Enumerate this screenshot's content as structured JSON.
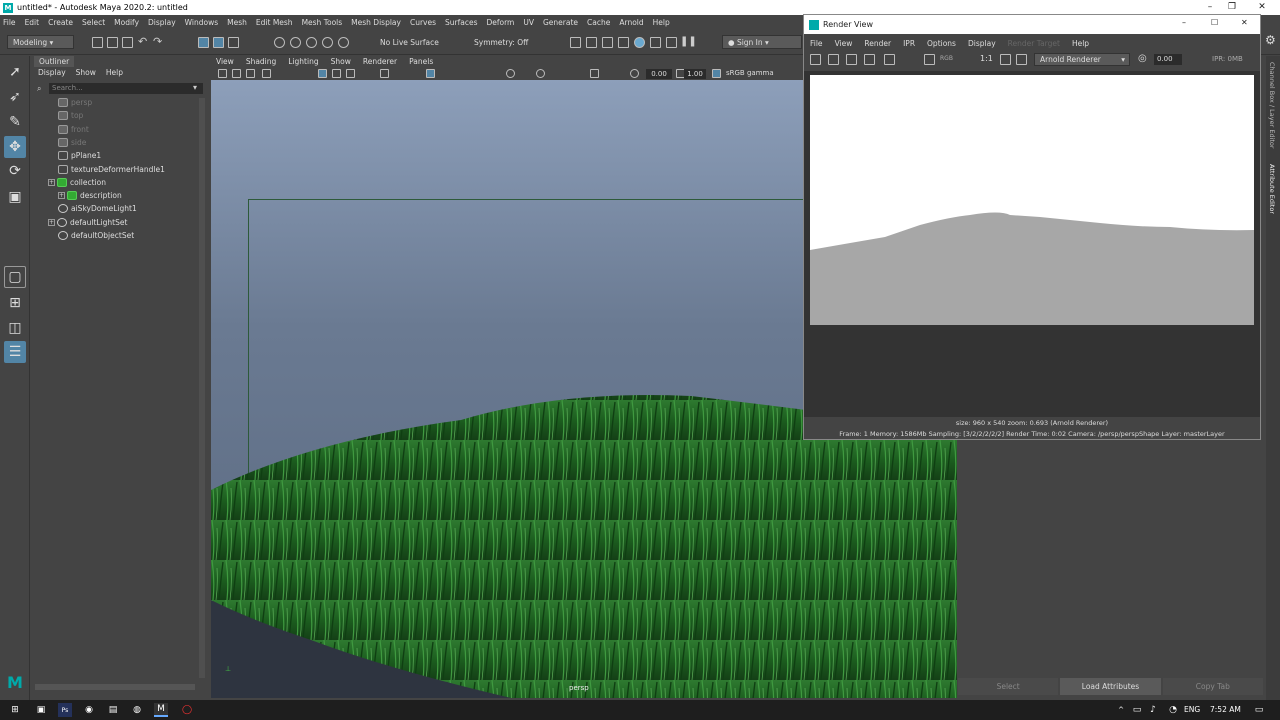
{
  "titlebar": {
    "title": "untitled* - Autodesk Maya 2020.2: untitled",
    "logo": "M"
  },
  "menus": [
    "File",
    "Edit",
    "Create",
    "Select",
    "Modify",
    "Display",
    "Windows",
    "Mesh",
    "Edit Mesh",
    "Mesh Tools",
    "Mesh Display",
    "Curves",
    "Surfaces",
    "Deform",
    "UV",
    "Generate",
    "Cache",
    "Arnold",
    "Help"
  ],
  "shelf": {
    "workspace": "Modeling",
    "live_surface": "No Live Surface",
    "symmetry": "Symmetry: Off",
    "sign_in": "Sign In"
  },
  "outliner": {
    "tab": "Outliner",
    "menu": [
      "Display",
      "Show",
      "Help"
    ],
    "search_placeholder": "Search...",
    "items": [
      {
        "label": "persp",
        "dim": true
      },
      {
        "label": "top",
        "dim": true
      },
      {
        "label": "front",
        "dim": true
      },
      {
        "label": "side",
        "dim": true
      },
      {
        "label": "pPlane1",
        "dim": false
      },
      {
        "label": "textureDeformerHandle1",
        "dim": false
      },
      {
        "label": "collection",
        "dim": false
      },
      {
        "label": "description",
        "dim": false
      },
      {
        "label": "aiSkyDomeLight1",
        "dim": false
      },
      {
        "label": "defaultLightSet",
        "dim": false
      },
      {
        "label": "defaultObjectSet",
        "dim": false
      }
    ]
  },
  "viewport": {
    "menu": [
      "View",
      "Shading",
      "Lighting",
      "Show",
      "Renderer",
      "Panels"
    ],
    "val1": "0.00",
    "val2": "1.00",
    "colorspace": "sRGB gamma",
    "camera_label": "persp"
  },
  "render_view": {
    "title": "Render View",
    "menu": [
      "File",
      "View",
      "Render",
      "IPR",
      "Options",
      "Display",
      "Render Target",
      "Help"
    ],
    "ratio": "1:1",
    "renderer": "Arnold Renderer",
    "value": "0.00",
    "ipr": "IPR: 0MB",
    "info_size": "size: 960 x 540  zoom: 0.693     (Arnold Renderer)",
    "info_stats": "Frame: 1     Memory: 1586Mb     Sampling: [3/2/2/2/2/2]     Render Time: 0:02     Camera: /persp/perspShape     Layer: masterLayer"
  },
  "attribute_editor": {
    "buttons": [
      "Select",
      "Load Attributes",
      "Copy Tab"
    ]
  },
  "side_tabs": [
    "Channel Box / Layer Editor",
    "Attribute Editor"
  ],
  "taskbar": {
    "lang": "ENG",
    "time": "7:52 AM"
  },
  "colors": {
    "selection": "#5285a6",
    "grass": "#1f6a22",
    "maya_teal": "#00a0a0"
  }
}
